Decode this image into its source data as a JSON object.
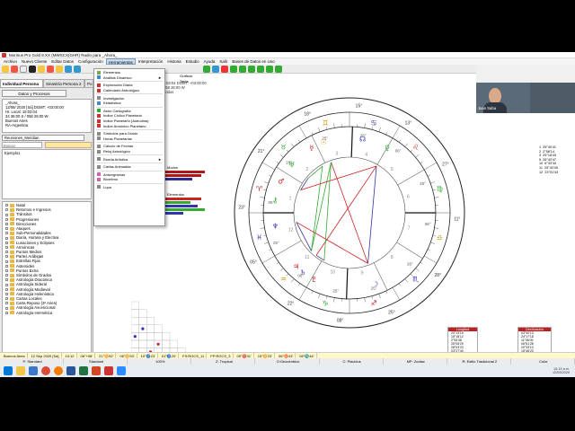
{
  "window": {
    "title": "Morinus Pro Gold 8.XX (MWSCX(GHR) Radio para _Ahora_"
  },
  "menu": {
    "items": [
      "Archivo",
      "Nuevo Cliente",
      "Editar Datos",
      "Configuración",
      "Herramientas",
      "Interpretación",
      "Historia",
      "Estudio",
      "Ayuda",
      "Salir",
      "Bases de Datos en Uso"
    ],
    "active_index": 4
  },
  "tabs": [
    "Individual Persona",
    "Sinastría Persona 2",
    "Po..."
  ],
  "left": {
    "datos_button": "Datos y Procesos",
    "info_lines": [
      "_Ahora_",
      "12/09/ 2020 [Sá]  DGMT: +03:00:00",
      "Hr. Local: 10:03:04",
      "34 36:00 S / 058 26:00 W",
      "Buenos Aires",
      "RA-Argentina"
    ],
    "combo_value": "Reuniones_Meridian",
    "search_label": "Buscar",
    "list_items": [
      "Ejemplo1"
    ],
    "tree_items": [
      "Natal",
      "Retornos e Ingresos",
      "Tránsitos",
      "Progresiones",
      "Direcciones",
      "Ataques",
      "Sub-Personalidades",
      "Diaria, Horaria y Electiva",
      "Lunaciones y Eclipses",
      "Armónicas",
      "Puntos Medios",
      "Partes Arábigas",
      "Estrellas Fijas",
      "Asteroides",
      "Puntos Extra",
      "Símbolos de Grados",
      "Astrología Dracónica",
      "Astrología Sideral",
      "Astrología Medieval",
      "Astrología Helenística",
      "Cartas Locales",
      "Carta Reposo (3º Aries)",
      "Astrología Ascencional",
      "Astrología Hermética"
    ],
    "events_button": "Análisis de Eventos - Activar"
  },
  "dropdown": {
    "items": [
      {
        "label": "Elementos",
        "color": "#7a4"
      },
      {
        "label": "Análisis Dinamico",
        "color": "#48c",
        "arrow": true
      },
      {
        "sep": true
      },
      {
        "label": "Exploración Diaria",
        "color": "#c33"
      },
      {
        "label": "Calendario Astrológico",
        "color": "#c33"
      },
      {
        "sep": true
      },
      {
        "label": "Investigación",
        "color": "#888"
      },
      {
        "label": "Estadística",
        "color": "#48c"
      },
      {
        "sep": true
      },
      {
        "label": "Astro Cartografía",
        "color": "#3a3"
      },
      {
        "label": "Indice Cíclico Planetario",
        "color": "#c33"
      },
      {
        "label": "Indice Planetario (Astrodina)",
        "color": "#c33"
      },
      {
        "label": "Indice Armónico Planetario",
        "color": "#c33"
      },
      {
        "sep": true
      },
      {
        "label": "Símbolos para Grado",
        "color": "#888"
      },
      {
        "label": "Horas Planetarias",
        "color": "#888"
      },
      {
        "sep": true
      },
      {
        "label": "Cálculo de Fechas",
        "color": "#888"
      },
      {
        "label": "Reloj Astrológico",
        "color": "#888"
      },
      {
        "sep": true
      },
      {
        "label": "Rueda Artística",
        "color": "#888",
        "arrow": true
      },
      {
        "sep": true
      },
      {
        "label": "Cartas Animadas",
        "color": "#888"
      },
      {
        "sep": true
      },
      {
        "label": "Aniwogramas",
        "color": "#c6a"
      },
      {
        "label": "Biorritmo",
        "color": "#c6a"
      },
      {
        "sep": true
      },
      {
        "label": "Lupa",
        "color": "#888"
      }
    ]
  },
  "chart_header": {
    "lines": [
      "05/09/ 2020  10:03:04  DGMT: +03:00:00",
      "| 34 36:00 S | 058 26:00 W",
      "Tropical  |  P.Placidus"
    ]
  },
  "tool_labels": [
    "Graficar",
    "Tabla"
  ],
  "mini_labels": [
    "Modos",
    "Elementos"
  ],
  "chart": {
    "house_cusps": [
      "06°",
      "26°",
      "25°",
      "25°",
      "06°",
      "25°",
      "06°",
      "26°",
      "25°",
      "25°",
      "06°",
      "25°"
    ],
    "outer_degrees": [
      "23°",
      "21°",
      "18°",
      "15°",
      "13°",
      "27°",
      "11°",
      "28°",
      "25°",
      "08°",
      "22°",
      "05°"
    ]
  },
  "webcam": {
    "label": "Juan Saba"
  },
  "right_houses": [
    [
      "1",
      "25°40'41"
    ],
    [
      "2",
      "2°58'14"
    ],
    [
      "3",
      "25°18'43"
    ],
    [
      "5",
      "26°40'47"
    ],
    [
      "10",
      "6°33'34"
    ],
    [
      "11",
      "25°40'45"
    ],
    [
      "12",
      "23°51'43"
    ]
  ],
  "longitud_title": "Longitud",
  "longitud_rows": [
    "20°13'15",
    "15°18'12",
    "2°53'38",
    "25°05'29",
    "28°03'23",
    "03°27'40",
    "13°52'30",
    "24°42'45",
    "20°35'45"
  ],
  "declinacion_title": "Declinación",
  "declinacion_rows": [
    "03°40'13",
    "24°17'18",
    "11°36'09",
    "06°51'28",
    "20°33'10",
    "15°46'23",
    "06°48'33",
    "21°29'50",
    "15°05'38"
  ],
  "statusbar": {
    "items": [
      "Buenos Aires",
      "12 Sep 2020 [Sá]",
      "10:12",
      "06°+08'",
      "21°♊52'",
      "06°♊53'",
      "10°♐23'",
      "01°♐20'",
      "FS:RGCS_11",
      "FP:RGCS_3",
      "05°♈31'",
      "15°♊23'",
      "06°♉43'",
      "06°♏46'"
    ]
  },
  "statusbar2": {
    "items": [
      "P: Standard",
      "Standard",
      "100%",
      "Z: Tropical",
      "O:Geocéntrico",
      "C: Placidus",
      "MP: Zodiac",
      "R: Estilo Tradicional 2",
      "Color"
    ]
  },
  "taskbar": {
    "time": "10:13 a.m.",
    "date": "12/09/2020"
  }
}
